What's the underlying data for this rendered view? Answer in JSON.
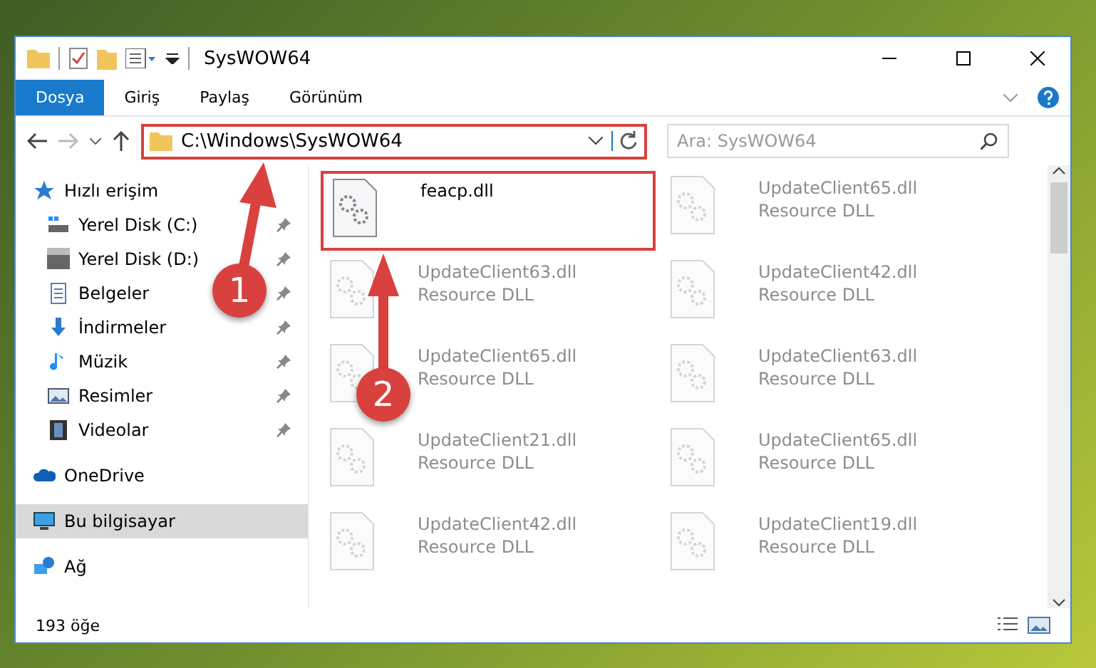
{
  "window": {
    "title": "SysWOW64"
  },
  "ribbon_tabs": [
    {
      "label": "Dosya",
      "selected": true
    },
    {
      "label": "Giriş",
      "selected": false
    },
    {
      "label": "Paylaş",
      "selected": false
    },
    {
      "label": "Görünüm",
      "selected": false
    }
  ],
  "address": {
    "value": "C:\\Windows\\SysWOW64",
    "highlighted": true
  },
  "search": {
    "placeholder": "Ara: SysWOW64"
  },
  "sidebar": {
    "items": [
      {
        "label": "Hızlı erişim",
        "kind": "star",
        "selected": false,
        "children": [
          {
            "label": "Yerel Disk (C:)",
            "kind": "system-disk",
            "pinned": true,
            "selected": false
          },
          {
            "label": "Yerel Disk (D:)",
            "kind": "disk",
            "pinned": true,
            "selected": false
          },
          {
            "label": "Belgeler",
            "kind": "document",
            "pinned": true,
            "selected": false
          },
          {
            "label": "İndirmeler",
            "kind": "download",
            "pinned": true,
            "selected": false
          },
          {
            "label": "Müzik",
            "kind": "music",
            "pinned": true,
            "selected": false
          },
          {
            "label": "Resimler",
            "kind": "picture",
            "pinned": true,
            "selected": false
          },
          {
            "label": "Videolar",
            "kind": "video",
            "pinned": true,
            "selected": false
          }
        ]
      },
      {
        "label": "OneDrive",
        "kind": "cloud",
        "selected": false
      },
      {
        "label": "Bu bilgisayar",
        "kind": "computer",
        "selected": true
      },
      {
        "label": "Ağ",
        "kind": "network",
        "selected": false
      }
    ]
  },
  "files": [
    {
      "name": "feacp.dll",
      "faded": false,
      "highlighted": true
    },
    {
      "name": "UpdateClient65.dll",
      "type": "Resource DLL",
      "faded": true,
      "highlighted": false
    },
    {
      "name": "UpdateClient63.dll",
      "type": "Resource DLL",
      "faded": true,
      "highlighted": false
    },
    {
      "name": "UpdateClient42.dll",
      "type": "Resource DLL",
      "faded": true,
      "highlighted": false
    },
    {
      "name": "UpdateClient65.dll",
      "type": "Resource DLL",
      "faded": true,
      "highlighted": false
    },
    {
      "name": "UpdateClient63.dll",
      "type": "Resource DLL",
      "faded": true,
      "highlighted": false
    },
    {
      "name": "UpdateClient21.dll",
      "type": "Resource DLL",
      "faded": true,
      "highlighted": false
    },
    {
      "name": "UpdateClient65.dll",
      "type": "Resource DLL",
      "faded": true,
      "highlighted": false
    },
    {
      "name": "UpdateClient42.dll",
      "type": "Resource DLL",
      "faded": true,
      "highlighted": false
    },
    {
      "name": "UpdateClient19.dll",
      "type": "Resource DLL",
      "faded": true,
      "highlighted": false
    }
  ],
  "status_bar": {
    "item_count": "193 öğe"
  },
  "callouts": [
    {
      "label": "1"
    },
    {
      "label": "2"
    }
  ]
}
